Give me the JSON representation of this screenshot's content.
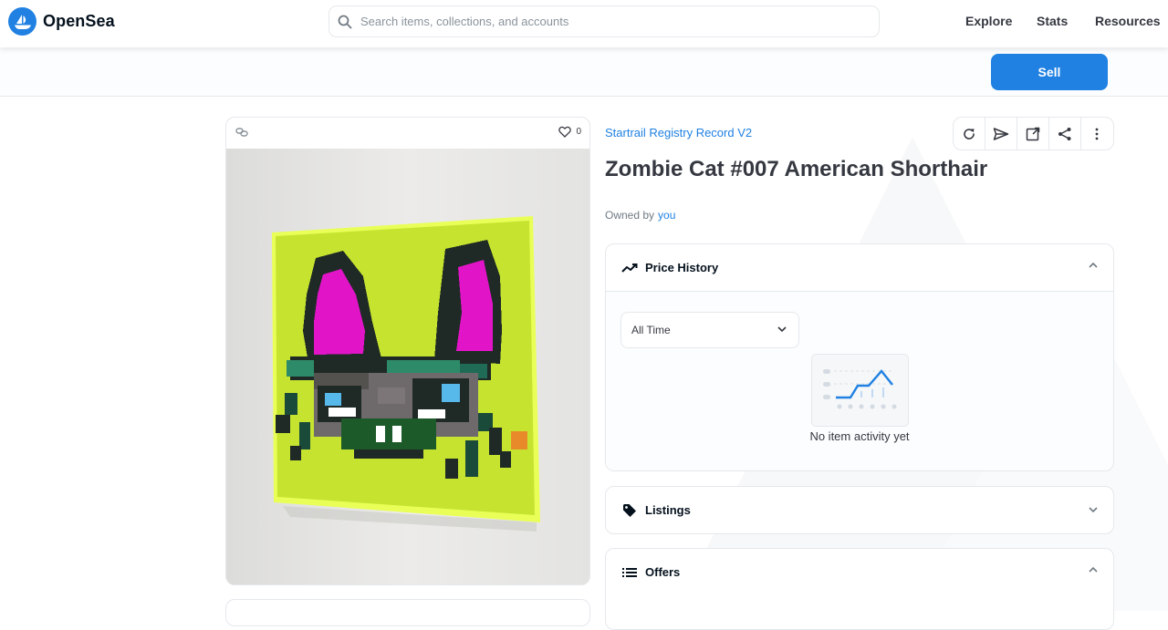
{
  "header": {
    "brand": "OpenSea",
    "search_placeholder": "Search items, collections, and accounts",
    "nav": [
      "Explore",
      "Stats",
      "Resources"
    ]
  },
  "owner_bar": {
    "sell_label": "Sell"
  },
  "asset": {
    "favorite_count": "0",
    "collection": "Startrail Registry Record V2",
    "title": "Zombie Cat #007 American Shorthair",
    "owned_by_label": "Owned by",
    "owner": "you"
  },
  "toolbar_icons": [
    "refresh-icon",
    "transfer-icon",
    "external-link-icon",
    "share-icon",
    "more-icon"
  ],
  "panels": {
    "price_history": {
      "title": "Price History",
      "select_value": "All Time",
      "empty_text": "No item activity yet"
    },
    "listings": {
      "title": "Listings"
    },
    "offers": {
      "title": "Offers"
    }
  },
  "colors": {
    "accent": "#2081e2",
    "artwork_background": "#c6e42f",
    "cat_ear_pink": "#e214c8",
    "cat_body_dark": "#1f2a26"
  }
}
